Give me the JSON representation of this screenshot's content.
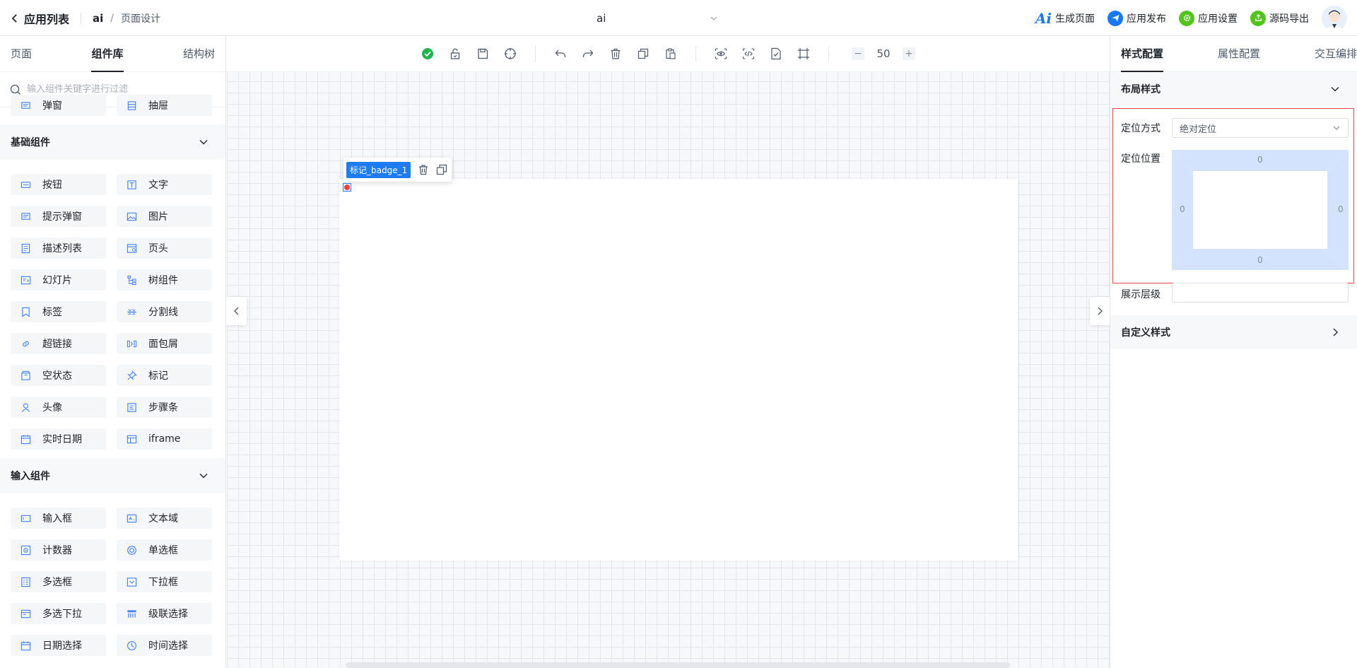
{
  "header": {
    "back_label": "应用列表",
    "app_crumb": "ai",
    "separator": "/",
    "page_crumb": "页面设计",
    "app_selector": "ai",
    "actions": [
      {
        "label": "生成页面",
        "icon": "ai-logo-icon"
      },
      {
        "label": "应用发布",
        "icon": "paper-plane-icon",
        "color": "#1677ff"
      },
      {
        "label": "应用设置",
        "icon": "gear-icon",
        "color": "#52c41a"
      },
      {
        "label": "源码导出",
        "icon": "export-icon",
        "color": "#52c41a"
      }
    ],
    "ai_logo_text": "Ai"
  },
  "left": {
    "tabs": [
      "页面",
      "组件库",
      "结构树"
    ],
    "active_tab": "组件库",
    "search_placeholder": "输入组件关键字进行过滤",
    "top_items": [
      {
        "label": "弹窗",
        "icon": "modal-icon"
      },
      {
        "label": "抽屉",
        "icon": "drawer-icon"
      }
    ],
    "sections": [
      {
        "title": "基础组件",
        "items": [
          {
            "label": "按钮",
            "icon": "button-icon"
          },
          {
            "label": "文字",
            "icon": "text-icon"
          },
          {
            "label": "提示弹窗",
            "icon": "toast-icon"
          },
          {
            "label": "图片",
            "icon": "image-icon"
          },
          {
            "label": "描述列表",
            "icon": "description-list-icon"
          },
          {
            "label": "页头",
            "icon": "page-header-icon"
          },
          {
            "label": "幻灯片",
            "icon": "carousel-icon"
          },
          {
            "label": "树组件",
            "icon": "tree-icon"
          },
          {
            "label": "标签",
            "icon": "tag-icon"
          },
          {
            "label": "分割线",
            "icon": "divider-icon"
          },
          {
            "label": "超链接",
            "icon": "link-icon"
          },
          {
            "label": "面包屑",
            "icon": "breadcrumb-icon"
          },
          {
            "label": "空状态",
            "icon": "empty-icon"
          },
          {
            "label": "标记",
            "icon": "pin-icon"
          },
          {
            "label": "头像",
            "icon": "avatar-icon"
          },
          {
            "label": "步骤条",
            "icon": "steps-icon"
          },
          {
            "label": "实时日期",
            "icon": "calendar-icon"
          },
          {
            "label": "iframe",
            "icon": "iframe-icon"
          }
        ]
      },
      {
        "title": "输入组件",
        "items": [
          {
            "label": "输入框",
            "icon": "input-icon"
          },
          {
            "label": "文本域",
            "icon": "textarea-icon"
          },
          {
            "label": "计数器",
            "icon": "counter-icon"
          },
          {
            "label": "单选框",
            "icon": "radio-icon"
          },
          {
            "label": "多选框",
            "icon": "checkbox-icon"
          },
          {
            "label": "下拉框",
            "icon": "select-icon"
          },
          {
            "label": "多选下拉",
            "icon": "multi-select-icon"
          },
          {
            "label": "级联选择",
            "icon": "cascader-icon"
          },
          {
            "label": "日期选择",
            "icon": "date-picker-icon"
          },
          {
            "label": "时间选择",
            "icon": "time-picker-icon"
          }
        ]
      }
    ]
  },
  "toolbar": {
    "zoom_minus": "−",
    "zoom_value": "50",
    "zoom_plus": "+"
  },
  "canvas": {
    "selected_label": "标记_badge_1"
  },
  "right": {
    "tabs": [
      "样式配置",
      "属性配置",
      "交互编排"
    ],
    "active_tab": "样式配置",
    "layout_section": "布局样式",
    "position_mode_label": "定位方式",
    "position_mode_value": "绝对定位",
    "position_label": "定位位置",
    "position_values": {
      "top": "0",
      "right": "0",
      "bottom": "0",
      "left": "0"
    },
    "z_index_label": "展示层级",
    "z_index_value": "",
    "custom_section": "自定义样式"
  }
}
